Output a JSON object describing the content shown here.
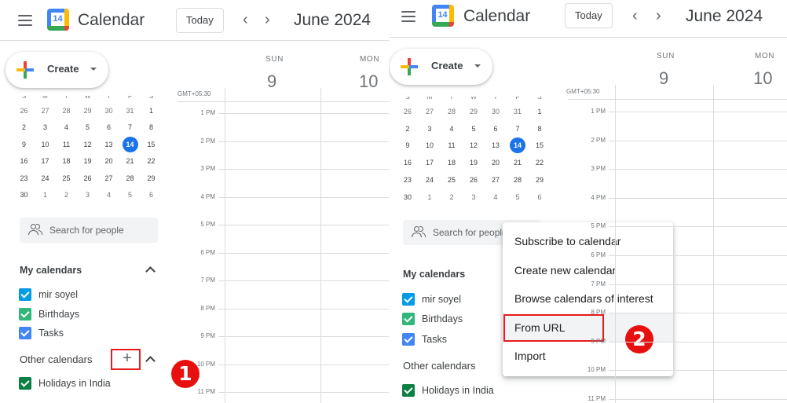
{
  "app": {
    "title": "Calendar",
    "logo_day": "14",
    "today_label": "Today",
    "prev_icon": "‹",
    "next_icon": "›",
    "month_title": "June 2024",
    "create_label": "Create",
    "timezone": "GMT+05:30"
  },
  "days": [
    {
      "dow": "SUN",
      "num": "9"
    },
    {
      "dow": "MON",
      "num": "10"
    }
  ],
  "mini_calendar": {
    "weekday_headers": [
      "S",
      "M",
      "T",
      "W",
      "T",
      "F",
      "S"
    ],
    "weeks": [
      [
        "26",
        "27",
        "28",
        "29",
        "30",
        "31",
        "1"
      ],
      [
        "2",
        "3",
        "4",
        "5",
        "6",
        "7",
        "8"
      ],
      [
        "9",
        "10",
        "11",
        "12",
        "13",
        "14",
        "15"
      ],
      [
        "16",
        "17",
        "18",
        "19",
        "20",
        "21",
        "22"
      ],
      [
        "23",
        "24",
        "25",
        "26",
        "27",
        "28",
        "29"
      ],
      [
        "30",
        "1",
        "2",
        "3",
        "4",
        "5",
        "6"
      ]
    ],
    "today": "14"
  },
  "search_people": {
    "placeholder": "Search for people"
  },
  "my_calendars": {
    "title": "My calendars",
    "items": [
      {
        "label": "mir soyel",
        "color": "#039be5"
      },
      {
        "label": "Birthdays",
        "color": "#33b679"
      },
      {
        "label": "Tasks",
        "color": "#4285f4"
      }
    ]
  },
  "other_calendars": {
    "title": "Other calendars",
    "add_icon": "+",
    "items": [
      {
        "label": "Holidays in India",
        "color": "#0b8043"
      }
    ]
  },
  "time_labels": [
    "1 PM",
    "2 PM",
    "3 PM",
    "4 PM",
    "5 PM",
    "6 PM",
    "7 PM",
    "8 PM",
    "9 PM",
    "10 PM",
    "11 PM"
  ],
  "add_menu": {
    "items": [
      "Subscribe to calendar",
      "Create new calendar",
      "Browse calendars of interest",
      "From URL",
      "Import"
    ],
    "highlighted": "From URL"
  },
  "annotations": {
    "step1": "1",
    "step2": "2",
    "highlight_color": "#e81c1c"
  }
}
